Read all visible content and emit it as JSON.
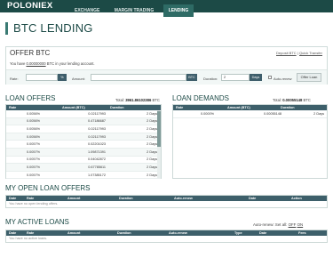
{
  "nav": {
    "logo": "POLONIEX",
    "items": [
      {
        "label": "EXCHANGE",
        "active": false
      },
      {
        "label": "MARGIN TRADING",
        "active": false
      },
      {
        "label": "LENDING",
        "active": true
      }
    ]
  },
  "page_title": "BTC LENDING",
  "offer": {
    "title": "OFFER BTC",
    "link_deposit": "Deposit BTC",
    "link_sep": "|",
    "link_transfer": "Quick Transfer",
    "balance_prefix": "You have",
    "balance_value": "0.00000000",
    "balance_suffix": "BTC in your lending account.",
    "rate_label": "Rate:",
    "rate_value": "",
    "rate_unit": "%",
    "amount_label": "Amount:",
    "amount_value": "",
    "amount_unit": "BTC",
    "duration_label": "Duration:",
    "duration_value": "2",
    "duration_unit": "Days",
    "autorenew_label": "Auto-renew",
    "button": "Offer Loan"
  },
  "loan_offers": {
    "title": "LOAN OFFERS",
    "total_label": "Total:",
    "total_value": "3961.86102386",
    "total_unit": "BTC",
    "columns": [
      "Rate",
      "Amount (BTC)",
      "Duration"
    ],
    "rows": [
      {
        "rate": "0.0056%",
        "amount": "0.02117993",
        "duration": "2 Days"
      },
      {
        "rate": "0.0056%",
        "amount": "0.47186687",
        "duration": "2 Days"
      },
      {
        "rate": "0.0056%",
        "amount": "0.02117993",
        "duration": "2 Days"
      },
      {
        "rate": "0.0056%",
        "amount": "0.02117993",
        "duration": "2 Days"
      },
      {
        "rate": "0.0057%",
        "amount": "0.02201023",
        "duration": "2 Days"
      },
      {
        "rate": "0.0057%",
        "amount": "1.09871391",
        "duration": "2 Days"
      },
      {
        "rate": "0.0057%",
        "amount": "0.04042872",
        "duration": "2 Days"
      },
      {
        "rate": "0.0057%",
        "amount": "0.67785611",
        "duration": "2 Days"
      },
      {
        "rate": "0.0057%",
        "amount": "1.07385172",
        "duration": "2 Days"
      }
    ]
  },
  "loan_demands": {
    "title": "LOAN DEMANDS",
    "total_label": "Total:",
    "total_value": "0.00055148",
    "total_unit": "BTC",
    "columns": [
      "Rate",
      "Amount (BTC)",
      "Duration"
    ],
    "rows": [
      {
        "rate": "0.0000%",
        "amount": "0.00055148",
        "duration": "2 Days"
      }
    ]
  },
  "open_offers": {
    "title": "MY OPEN LOAN OFFERS",
    "columns": [
      "Date",
      "Rate",
      "Amount",
      "Duration",
      "Auto-renew",
      "Date",
      "Action"
    ],
    "empty": "You have no open lending offers."
  },
  "active_loans": {
    "title": "MY ACTIVE LOANS",
    "autorenew_prefix": "Auto-renew: Set all:",
    "autorenew_off": "OFF",
    "autorenew_on": "ON",
    "columns": [
      "Date",
      "Rate",
      "Amount",
      "Duration",
      "Auto-renew",
      "Type",
      "Date",
      "Fees"
    ],
    "empty": "You have no active loans."
  }
}
